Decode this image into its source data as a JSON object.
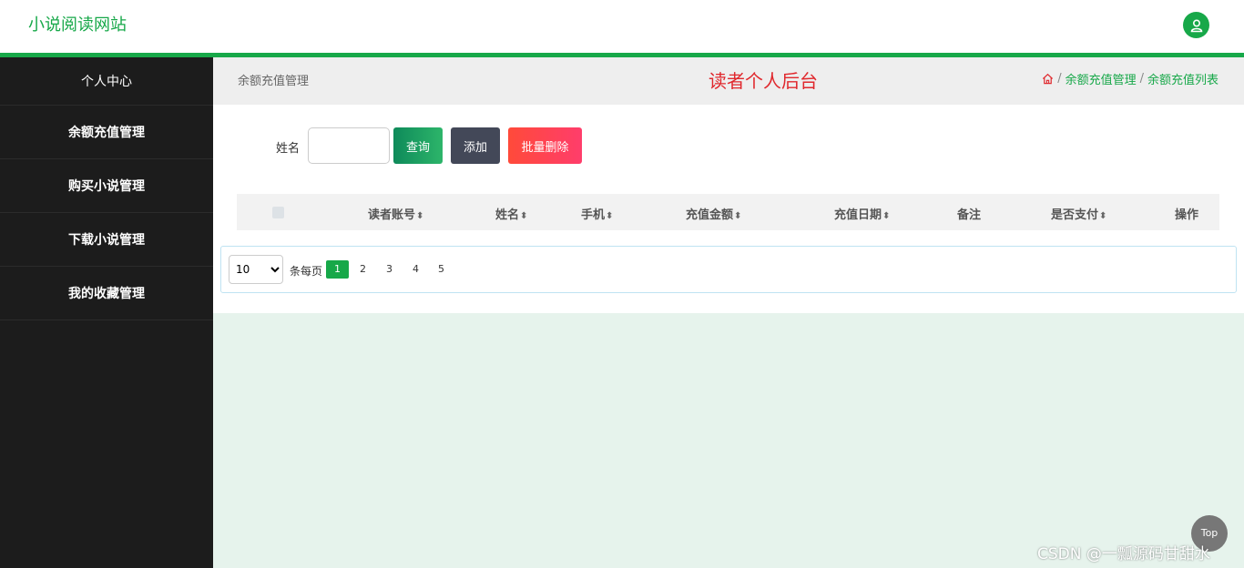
{
  "header": {
    "brand": "小说阅读网站",
    "user_icon": "user-icon"
  },
  "sidebar": {
    "items": [
      {
        "label": "个人中心"
      },
      {
        "label": "余额充值管理"
      },
      {
        "label": "购买小说管理"
      },
      {
        "label": "下载小说管理"
      },
      {
        "label": "我的收藏管理"
      }
    ]
  },
  "main": {
    "section_name": "余额充值管理",
    "page_title": "读者个人后台",
    "breadcrumb": [
      "余额充值管理",
      "余额充值列表"
    ],
    "breadcrumb_sep": "/"
  },
  "search": {
    "label": "姓名",
    "value": "",
    "query_label": "查询",
    "add_label": "添加",
    "batch_delete_label": "批量删除"
  },
  "table": {
    "columns": [
      "读者账号",
      "姓名",
      "手机",
      "充值金额",
      "充值日期",
      "备注",
      "是否支付",
      "操作"
    ]
  },
  "pager": {
    "page_size": "10",
    "per_page_label": "条每页",
    "pages": [
      "1",
      "2",
      "3",
      "4",
      "5"
    ],
    "current": "1"
  },
  "float": {
    "top_label": "Top",
    "watermark": "CSDN @一瓢源码甘甜水"
  },
  "colors": {
    "accent": "#17a849",
    "title_red": "#e0282d",
    "sidebar_bg": "#1c1c1c"
  }
}
